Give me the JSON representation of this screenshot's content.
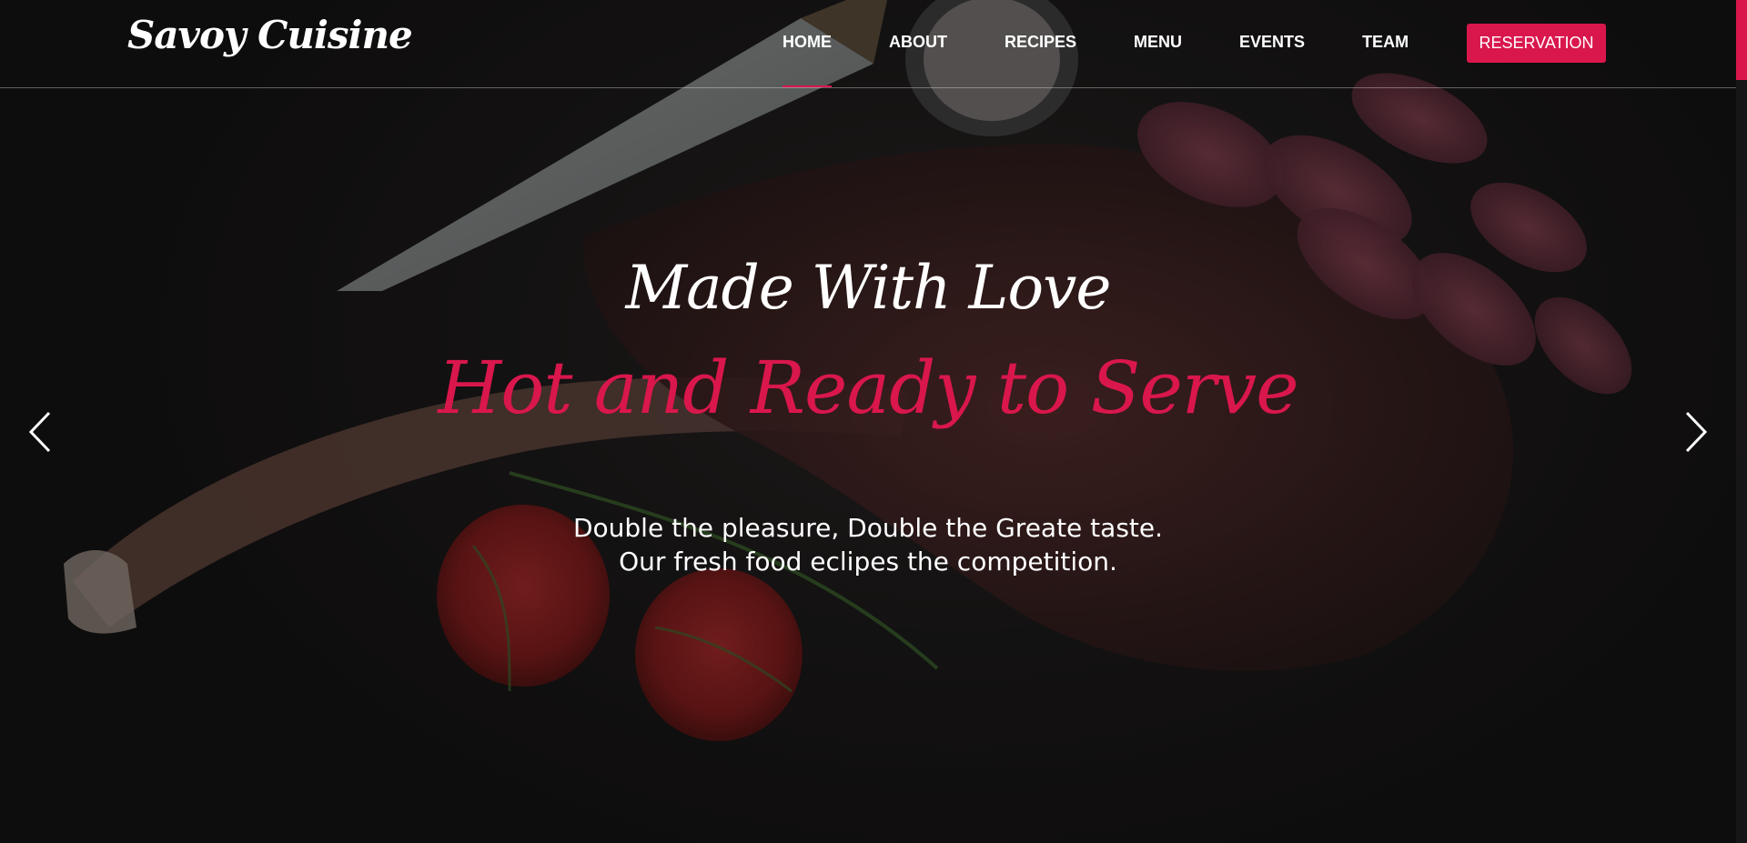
{
  "brand": {
    "logo_text": "Savoy Cuisine"
  },
  "nav": {
    "items": [
      {
        "label": "HOME"
      },
      {
        "label": "ABOUT"
      },
      {
        "label": "RECIPES"
      },
      {
        "label": "MENU"
      },
      {
        "label": "EVENTS"
      },
      {
        "label": "TEAM"
      }
    ],
    "active": "HOME",
    "reservation_label": "RESERVATION"
  },
  "hero": {
    "subtitle": "Made With Love",
    "title": "Hot and Ready to Serve",
    "description_line1": "Double the pleasure, Double the Greate taste.",
    "description_line2": "Our fresh food eclipes the competition."
  },
  "carousel": {
    "prev_icon": "chevron-left-icon",
    "next_icon": "chevron-right-icon"
  },
  "colors": {
    "accent": "#d9174d",
    "background": "#141212",
    "text": "#ffffff"
  }
}
